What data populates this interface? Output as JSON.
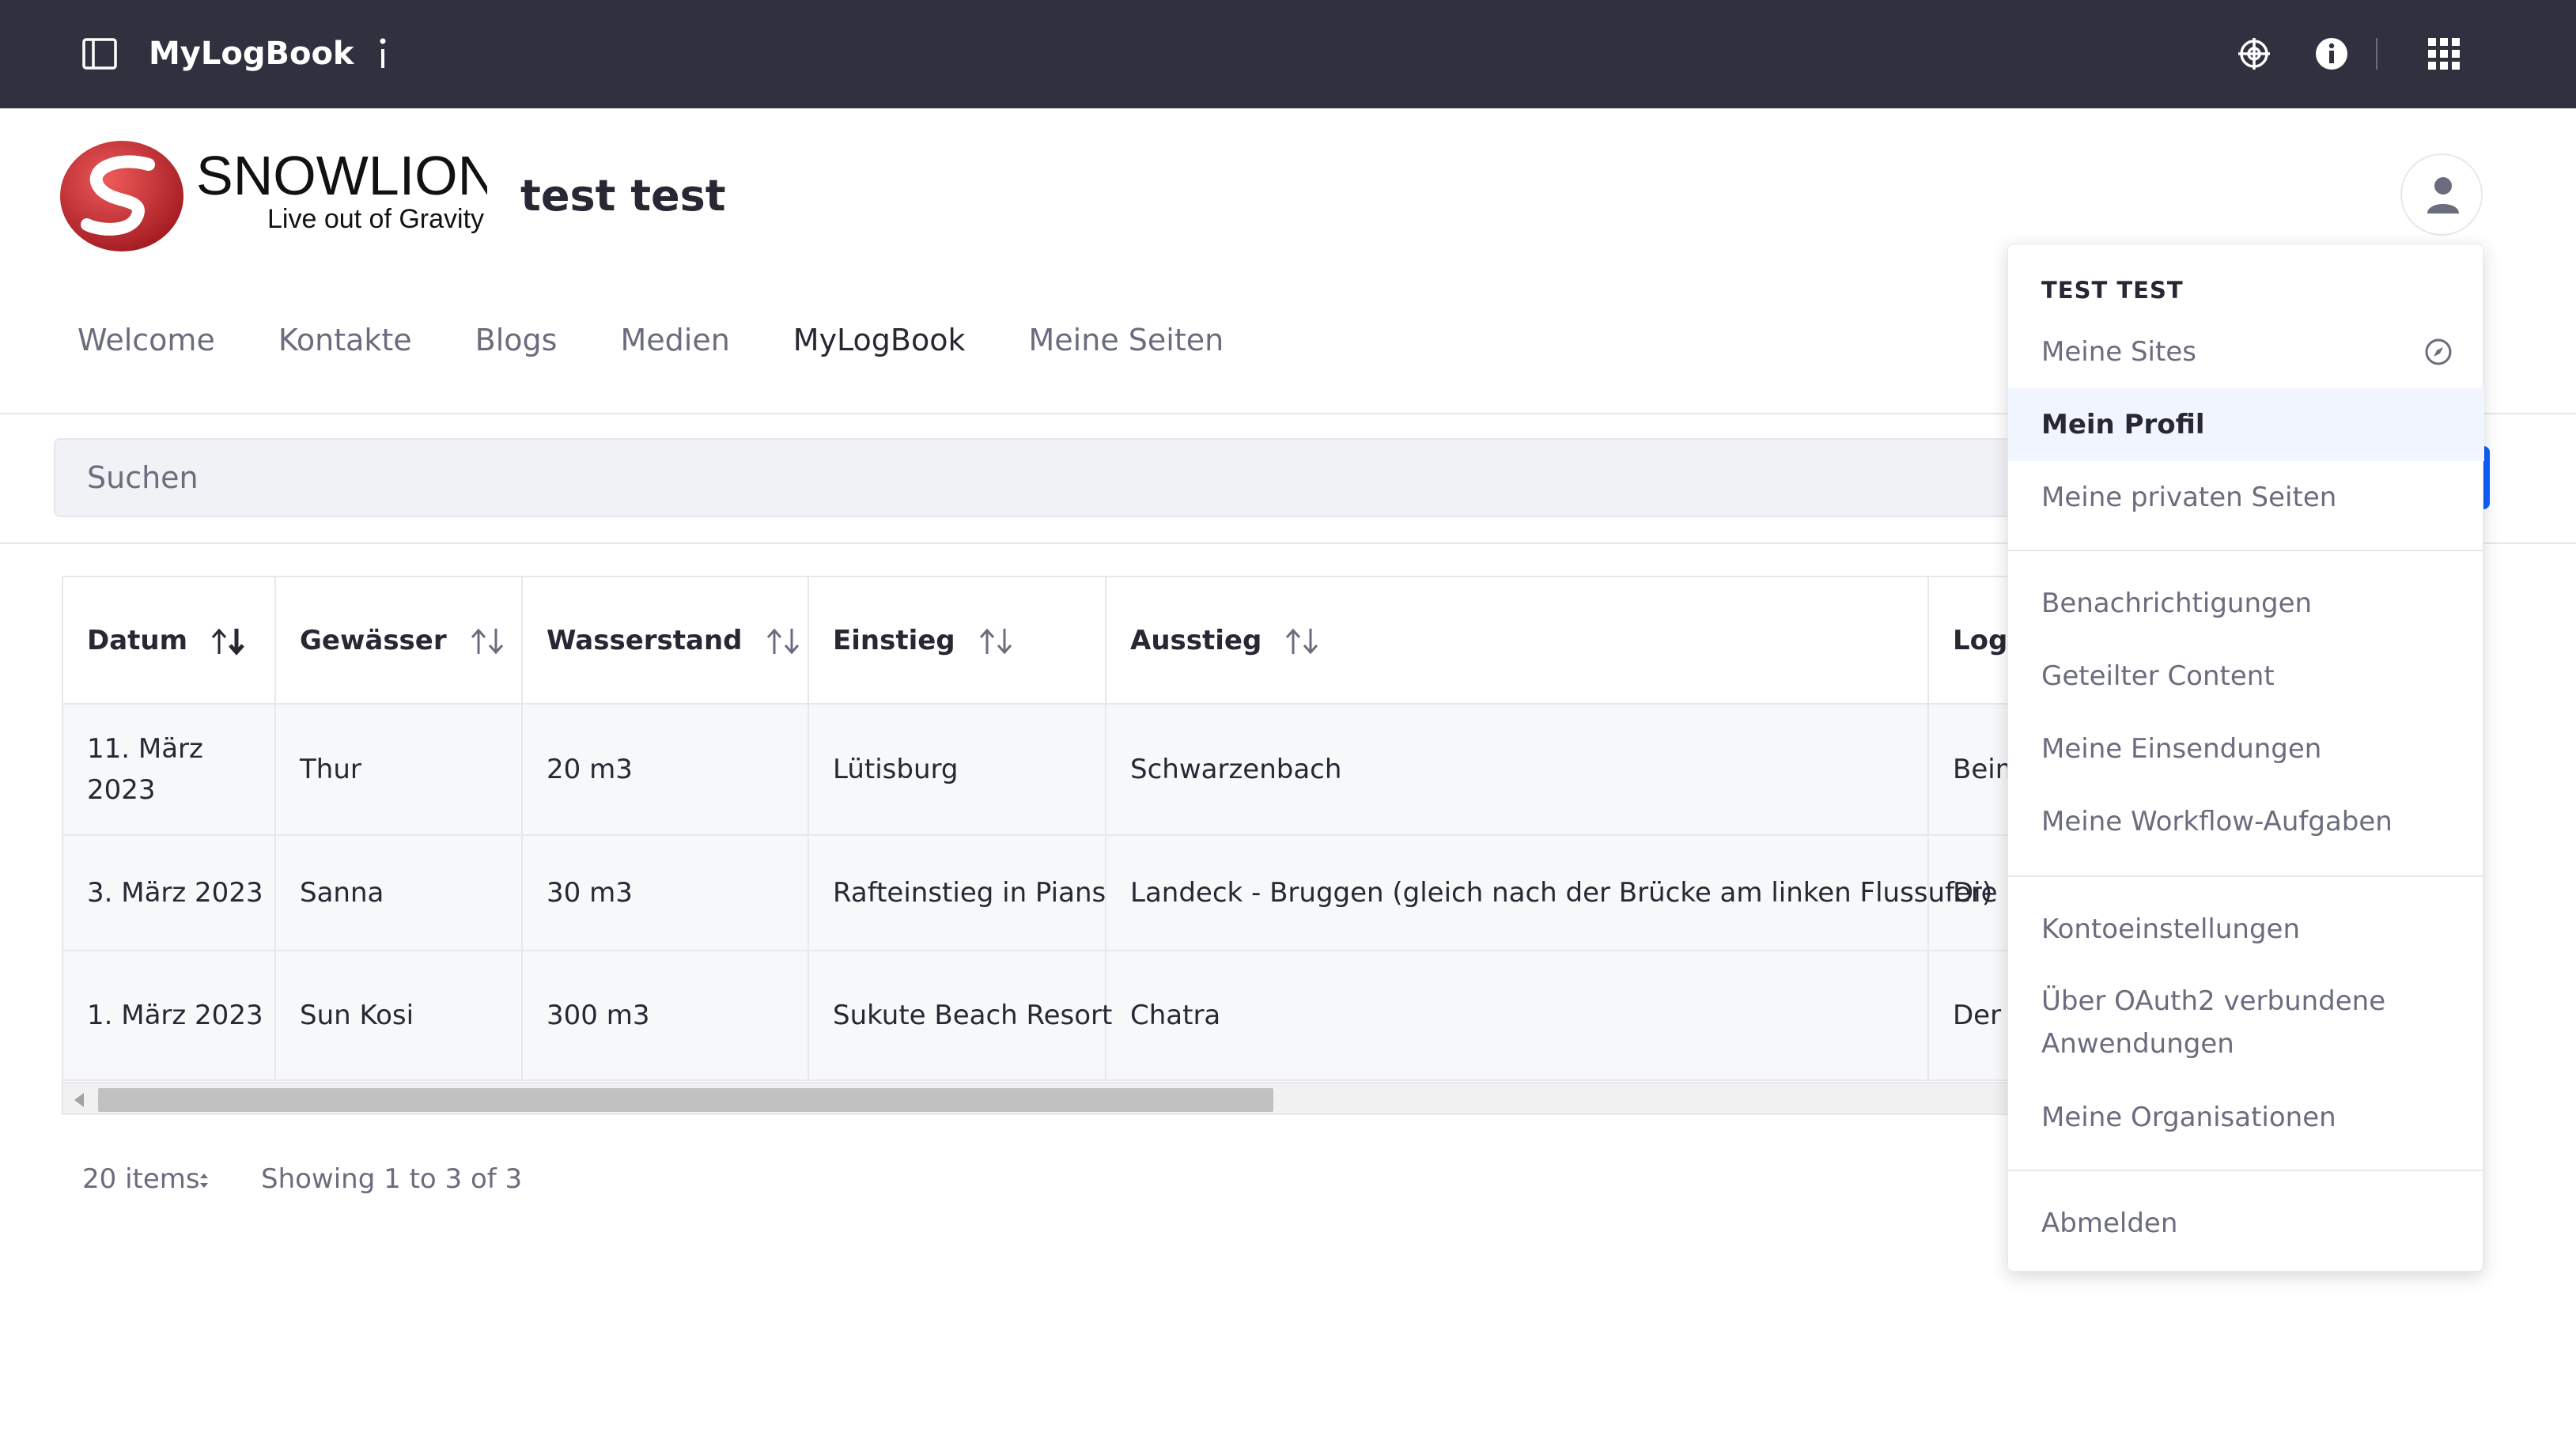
{
  "topbar": {
    "app_title": "MyLogBook",
    "icons": [
      "panel-toggle-icon",
      "info-i-icon",
      "target-icon",
      "info-circle-icon",
      "apps-grid-icon"
    ]
  },
  "header": {
    "logo_name": "SNOWLION",
    "logo_tagline": "Live out of Gravity",
    "site_name": "test test"
  },
  "nav": {
    "items": [
      "Welcome",
      "Kontakte",
      "Blogs",
      "Medien",
      "MyLogBook",
      "Meine Seiten"
    ],
    "active_index": 4
  },
  "search": {
    "placeholder": "Suchen"
  },
  "table": {
    "columns": [
      "Datum",
      "Gewässer",
      "Wasserstand",
      "Einstieg",
      "Ausstieg",
      "Log-"
    ],
    "rows": [
      [
        "11. März 2023",
        "Thur",
        "20 m3",
        "Lütisburg",
        "Schwarzenbach",
        "Beim"
      ],
      [
        "3. März 2023",
        "Sanna",
        "30 m3",
        "Rafteinstieg in Pians",
        "Landeck - Bruggen (gleich nach der Brücke am linken Flussufer)",
        "Die S"
      ],
      [
        "1. März 2023",
        "Sun Kosi",
        "300 m3",
        "Sukute Beach Resort",
        "Chatra",
        "Der S"
      ]
    ]
  },
  "pagination": {
    "items_per_page": "20 items",
    "showing": "Showing 1 to 3 of 3"
  },
  "user_menu": {
    "header": "TEST TEST",
    "items": [
      "Meine Sites",
      "Mein Profil",
      "Meine privaten Seiten",
      "Benachrichtigungen",
      "Geteilter Content",
      "Meine Einsendungen",
      "Meine Workflow-Aufgaben",
      "Kontoeinstellungen",
      "Über OAuth2 verbundene Anwendungen",
      "Meine Organisationen",
      "Abmelden"
    ],
    "active_item": "Mein Profil"
  },
  "colors": {
    "topbar": "#30313f",
    "accent": "#0b5fff",
    "logo_red": "#c8242b"
  }
}
